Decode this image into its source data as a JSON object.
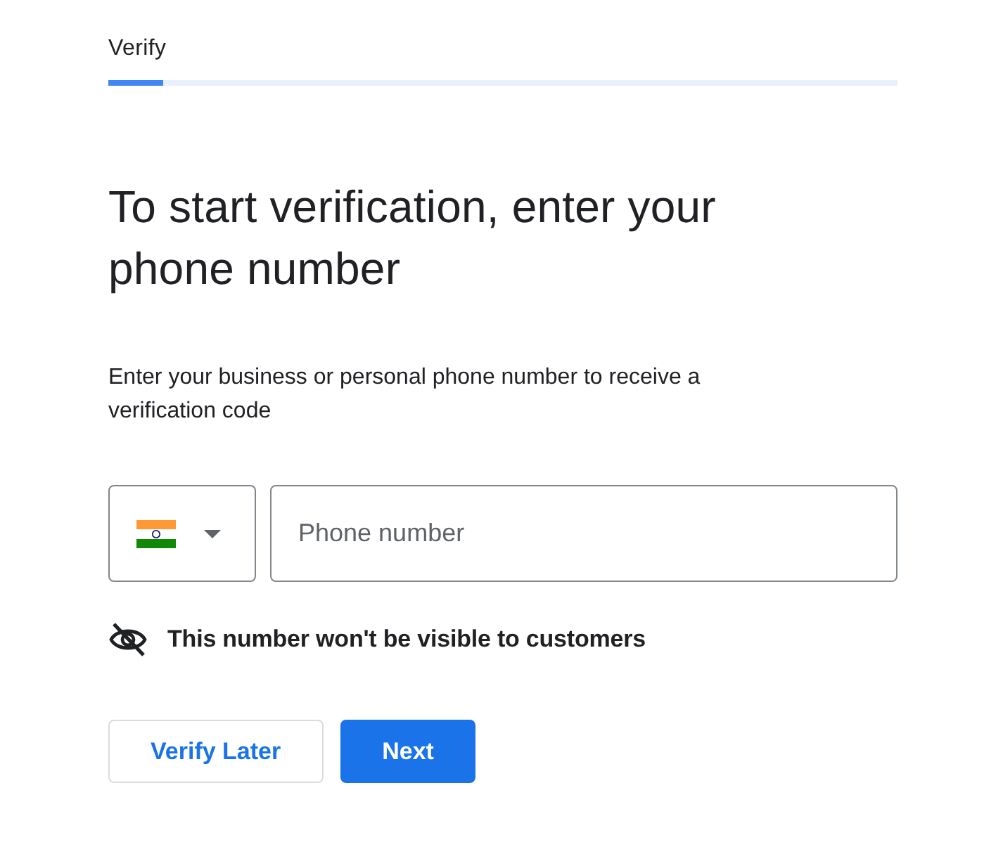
{
  "header": {
    "title": "Verify",
    "progress": {
      "level": 0.07
    }
  },
  "heading": "To start verification, enter your phone number",
  "description": "Enter your business or personal phone number to receive a verification code",
  "phone": {
    "placeholder": "Phone number"
  },
  "notice": "This number won't be visible to customers",
  "buttons": [
    {
      "label": "Verify Later",
      "kind": "secondary"
    },
    {
      "label": "Next",
      "kind": "primary"
    }
  ]
}
